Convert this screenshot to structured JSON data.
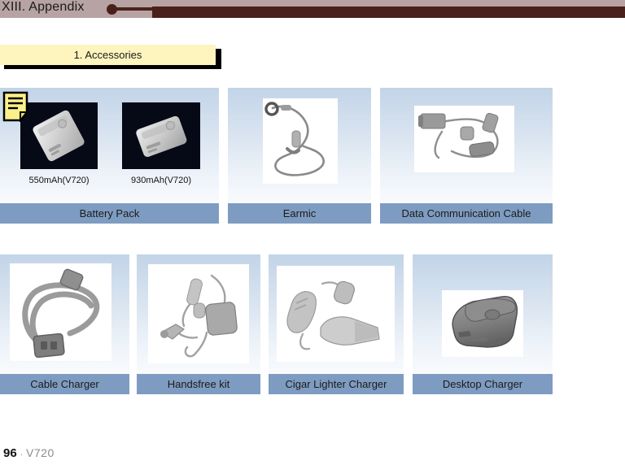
{
  "header": {
    "title": "XIII. Appendix",
    "band_color": "#b7a3a3",
    "bar_color": "#4a211a"
  },
  "section": {
    "title": "1. Accessories",
    "background_color": "#fdf5bd",
    "shadow_color": "#000000"
  },
  "note_icon": {
    "name": "note-icon",
    "fill_color": "#fbf08a",
    "border_color": "#000000"
  },
  "card_style": {
    "gradient_top": "#c2d4e8",
    "gradient_bottom": "#ffffff",
    "label_bar_color": "#7e9cc1",
    "label_text_color": "#1b1b1b"
  },
  "rows": [
    {
      "cards": [
        {
          "label": "Battery Pack",
          "icon": "battery-pack-image",
          "sub_items": [
            {
              "caption": "550mAh(V720)"
            },
            {
              "caption": "930mAh(V720)"
            }
          ]
        },
        {
          "label": "Earmic",
          "icon": "earmic-image",
          "sub_items": []
        },
        {
          "label": "Data Communication Cable",
          "icon": "data-communication-cable-image",
          "sub_items": []
        }
      ]
    },
    {
      "cards": [
        {
          "label": "Cable Charger",
          "icon": "cable-charger-image",
          "sub_items": []
        },
        {
          "label": "Handsfree kit",
          "icon": "handsfree-kit-image",
          "sub_items": []
        },
        {
          "label": "Cigar Lighter Charger",
          "icon": "cigar-lighter-charger-image",
          "sub_items": []
        },
        {
          "label": "Desktop Charger",
          "icon": "desktop-charger-image",
          "sub_items": []
        }
      ]
    }
  ],
  "footer": {
    "page_number": "96",
    "separator": "·",
    "model": "V720"
  }
}
